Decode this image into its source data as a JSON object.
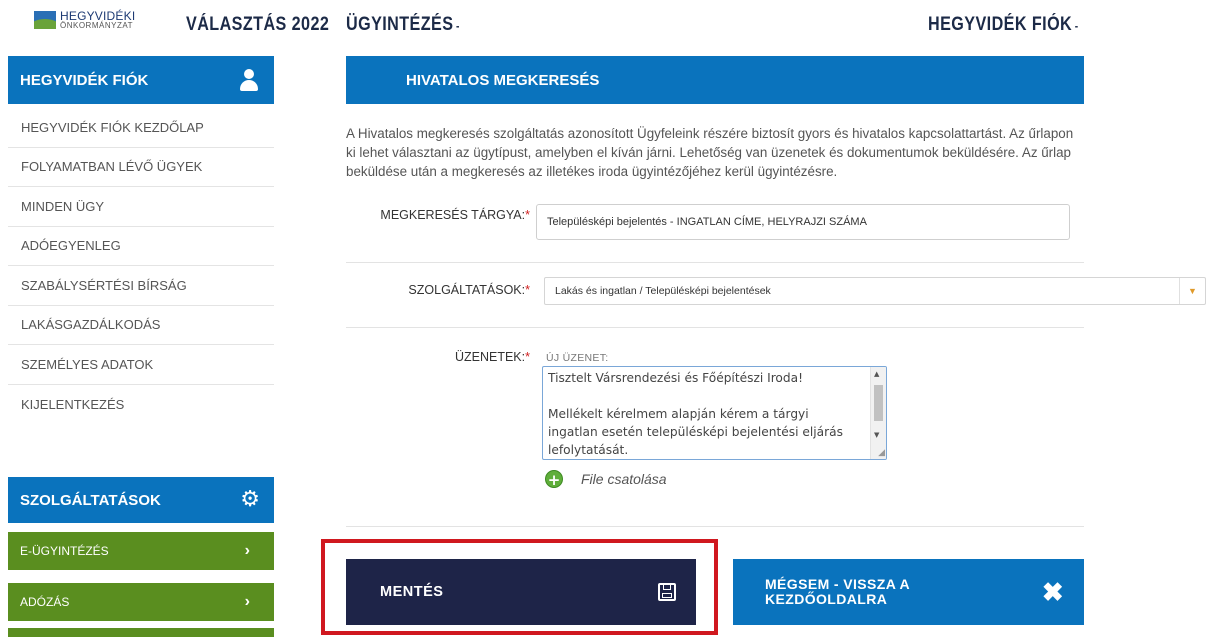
{
  "brand": {
    "logo_line1": "HEGYVIDÉKI",
    "logo_line2": "ÖNKORMÁNYZAT"
  },
  "topnav": {
    "items": [
      {
        "label": "VÁLASZTÁS 2022"
      },
      {
        "label": "ÜGYINTÉZÉS",
        "caret": "-"
      },
      {
        "label": "HEGYVIDÉK FIÓK",
        "caret": "-"
      }
    ]
  },
  "sidebar": {
    "header": "HEGYVIDÉK FIÓK",
    "header_icon": "user-icon",
    "items": [
      {
        "label": "HEGYVIDÉK FIÓK KEZDŐLAP"
      },
      {
        "label": "FOLYAMATBAN LÉVŐ ÜGYEK"
      },
      {
        "label": "MINDEN ÜGY"
      },
      {
        "label": "ADÓEGYENLEG"
      },
      {
        "label": "SZABÁLYSÉRTÉSI BÍRSÁG"
      },
      {
        "label": "LAKÁSGAZDÁLKODÁS"
      },
      {
        "label": "SZEMÉLYES ADATOK"
      },
      {
        "label": "KIJELENTKEZÉS"
      }
    ],
    "services_header": "SZOLGÁLTATÁSOK",
    "services_icon": "gears-icon",
    "services": [
      {
        "label": "E-ÜGYINTÉZÉS",
        "chevron": "›"
      },
      {
        "label": "ADÓZÁS",
        "chevron": "›"
      }
    ]
  },
  "main": {
    "title": "HIVATALOS MEGKERESÉS",
    "intro": "A Hivatalos megkeresés szolgáltatás azonosított Ügyfeleink részére biztosít gyors és hivatalos kapcsolattartást. Az űrlapon ki lehet választani az ügytípust, amelyben el kíván járni. Lehetőség van üzenetek és dokumentumok beküldésére. Az űrlap beküldése után a megkeresés az illetékes iroda ügyintézőjéhez kerül ügyintézésre.",
    "form": {
      "subject_label": "MEGKERESÉS TÁRGYA:",
      "subject_value": "Településképi bejelentés - INGATLAN CÍME, HELYRAJZI SZÁMA",
      "services_label": "SZOLGÁLTATÁSOK:",
      "services_value": "Lakás és ingatlan / Településképi bejelentések",
      "messages_label": "ÜZENETEK:",
      "new_message_label": "ÚJ ÜZENET:",
      "message_text": "Tisztelt Vársrendezési és Főépítészi Iroda!\n\nMellékelt kérelmem alapján kérem a tárgyi ingatlan esetén településképi bejelentési eljárás lefolytatását.",
      "required_mark": "*",
      "attach_label": "File csatolása"
    },
    "actions": {
      "save_label": "MENTÉS",
      "cancel_label": "MÉGSEM - VISSZA A KEZDŐOLDALRA"
    }
  },
  "colors": {
    "primary_blue": "#0a73bd",
    "save_navy": "#1e2448",
    "service_green": "#5a8e1f",
    "highlight_red": "#d0181f"
  }
}
